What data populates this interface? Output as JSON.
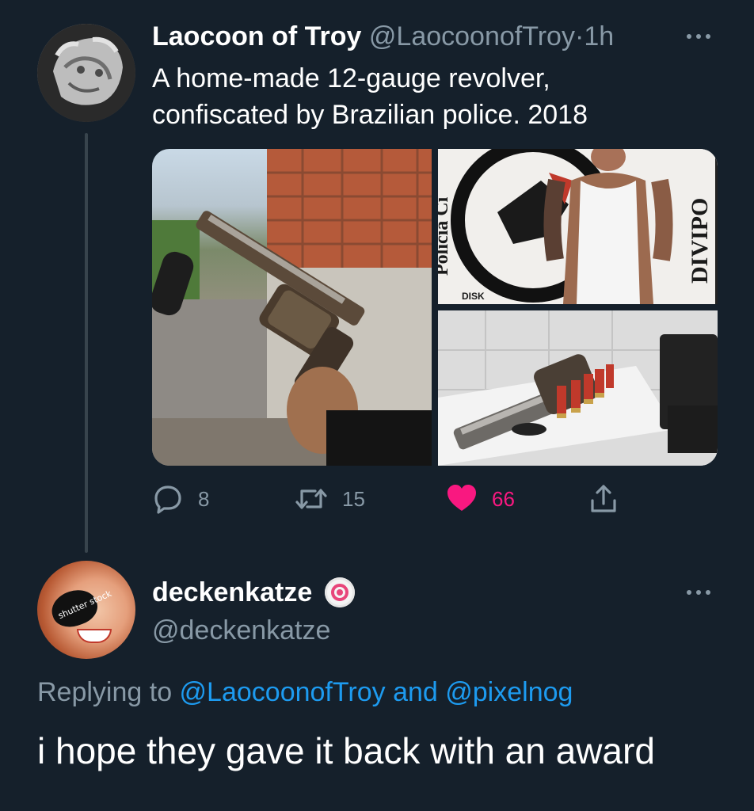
{
  "tweet": {
    "author_name": "Laocoon of Troy",
    "author_handle": "@LaocoonofTroy",
    "separator": "·",
    "time": "1h",
    "text_line1": "A home-made 12-gauge revolver,",
    "text_line2": "confiscated by Brazilian police. 2018",
    "stats": {
      "replies": "8",
      "retweets": "15",
      "likes": "66"
    },
    "media": {
      "right_top_sign_1": "Polícia Ci",
      "right_top_sign_2": "DIVIPO",
      "right_top_sign_3": "DISK"
    }
  },
  "reply": {
    "author_name": "deckenkatze",
    "author_handle": "@deckenkatze",
    "avatar_text": "shutter stock",
    "replying_prefix": "Replying to ",
    "replying_to_1": "@LaocoonofTroy",
    "replying_and": " and ",
    "replying_to_2": "@pixelnog",
    "text": "i hope they gave it back with an award"
  },
  "colors": {
    "background": "#15202b",
    "muted": "#8899a6",
    "link": "#1d9bf0",
    "like": "#f91880"
  },
  "icons": {
    "reply": "reply-icon",
    "retweet": "retweet-icon",
    "like": "heart-icon",
    "share": "share-icon",
    "more": "more-icon"
  }
}
